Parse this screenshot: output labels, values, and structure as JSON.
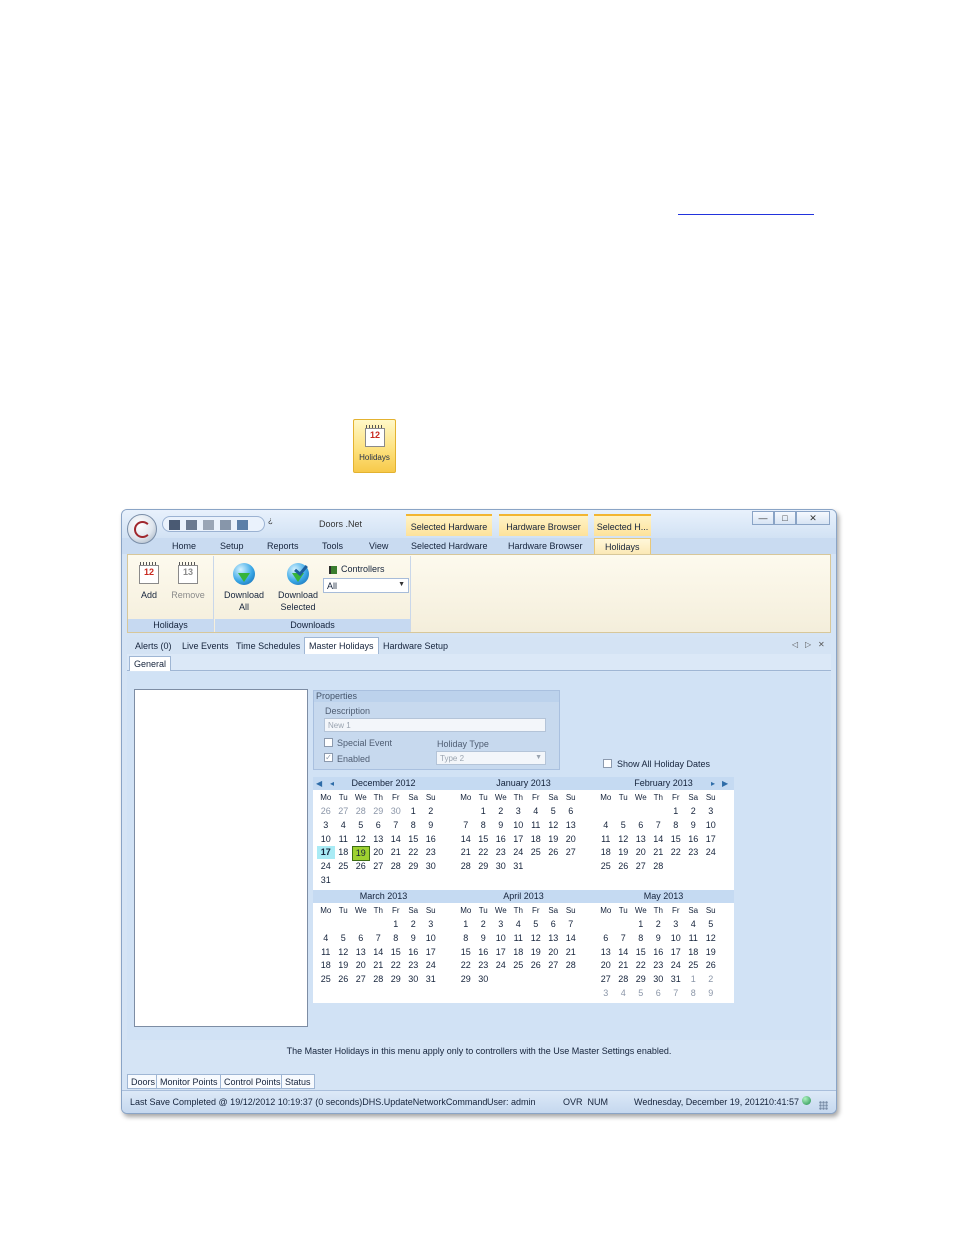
{
  "document": {
    "icon_button_label": "Holidays"
  },
  "window": {
    "quick_access_dropdown": "¿",
    "title": "Doors .Net",
    "context_tabs": [
      "Selected Hardware",
      "Hardware Browser",
      "Selected H..."
    ],
    "controls": {
      "minimize": "—",
      "maximize": "□",
      "close": "✕"
    }
  },
  "menu": {
    "tabs": [
      "Home",
      "Setup",
      "Reports",
      "Tools",
      "View",
      "Selected Hardware",
      "Hardware Browser",
      "Holidays"
    ],
    "active": "Holidays"
  },
  "ribbon": {
    "holidays_group": {
      "caption": "Holidays",
      "add": "Add",
      "remove": "Remove"
    },
    "downloads_group": {
      "caption": "Downloads",
      "download_all": [
        "Download",
        "All"
      ],
      "download_selected": [
        "Download",
        "Selected"
      ],
      "controllers_label": "Controllers",
      "controllers_value": "All"
    }
  },
  "doc_tabs": {
    "items": [
      "Alerts (0)",
      "Live Events",
      "Time Schedules",
      "Master Holidays",
      "Hardware Setup"
    ],
    "active": "Master Holidays",
    "nav": [
      "◁",
      "▷",
      "✕"
    ]
  },
  "sub_tabs": {
    "items": [
      "General"
    ]
  },
  "properties": {
    "caption": "Properties",
    "description_label": "Description",
    "description_value": "New 1",
    "special_event_label": "Special Event",
    "special_event_checked": false,
    "enabled_label": "Enabled",
    "enabled_checked": true,
    "holiday_type_label": "Holiday Type",
    "holiday_type_value": "Type 2"
  },
  "show_all_holiday_dates": {
    "label": "Show All Holiday Dates",
    "checked": false
  },
  "calendar": {
    "weekdays": [
      "Mo",
      "Tu",
      "We",
      "Th",
      "Fr",
      "Sa",
      "Su"
    ],
    "today": "17",
    "selected": "19",
    "months": [
      {
        "title": "December 2012",
        "days": [
          "26",
          "27",
          "28",
          "29",
          "30",
          "1",
          "2",
          "3",
          "4",
          "5",
          "6",
          "7",
          "8",
          "9",
          "10",
          "11",
          "12",
          "13",
          "14",
          "15",
          "16",
          "17",
          "18",
          "19",
          "20",
          "21",
          "22",
          "23",
          "24",
          "25",
          "26",
          "27",
          "28",
          "29",
          "30",
          "31"
        ],
        "lead": 5,
        "trail": 0
      },
      {
        "title": "January 2013",
        "days": [
          "1",
          "2",
          "3",
          "4",
          "5",
          "6",
          "7",
          "8",
          "9",
          "10",
          "11",
          "12",
          "13",
          "14",
          "15",
          "16",
          "17",
          "18",
          "19",
          "20",
          "21",
          "22",
          "23",
          "24",
          "25",
          "26",
          "27",
          "28",
          "29",
          "30",
          "31"
        ],
        "offset": 1
      },
      {
        "title": "February 2013",
        "days": [
          "1",
          "2",
          "3",
          "4",
          "5",
          "6",
          "7",
          "8",
          "9",
          "10",
          "11",
          "12",
          "13",
          "14",
          "15",
          "16",
          "17",
          "18",
          "19",
          "20",
          "21",
          "22",
          "23",
          "24",
          "25",
          "26",
          "27",
          "28"
        ],
        "offset": 4
      },
      {
        "title": "March 2013",
        "days": [
          "1",
          "2",
          "3",
          "4",
          "5",
          "6",
          "7",
          "8",
          "9",
          "10",
          "11",
          "12",
          "13",
          "14",
          "15",
          "16",
          "17",
          "18",
          "19",
          "20",
          "21",
          "22",
          "23",
          "24",
          "25",
          "26",
          "27",
          "28",
          "29",
          "30",
          "31"
        ],
        "offset": 4
      },
      {
        "title": "April 2013",
        "days": [
          "1",
          "2",
          "3",
          "4",
          "5",
          "6",
          "7",
          "8",
          "9",
          "10",
          "11",
          "12",
          "13",
          "14",
          "15",
          "16",
          "17",
          "18",
          "19",
          "20",
          "21",
          "22",
          "23",
          "24",
          "25",
          "26",
          "27",
          "28",
          "29",
          "30"
        ],
        "offset": 0
      },
      {
        "title": "May 2013",
        "days": [
          "1",
          "2",
          "3",
          "4",
          "5",
          "6",
          "7",
          "8",
          "9",
          "10",
          "11",
          "12",
          "13",
          "14",
          "15",
          "16",
          "17",
          "18",
          "19",
          "20",
          "21",
          "22",
          "23",
          "24",
          "25",
          "26",
          "27",
          "28",
          "29",
          "30",
          "31",
          "1",
          "2",
          "3",
          "4",
          "5",
          "6",
          "7",
          "8",
          "9"
        ],
        "offset": 2,
        "trail": 9
      }
    ]
  },
  "footnote": "The Master Holidays in this menu apply only to controllers with the Use Master Settings enabled.",
  "bottom_tabs": [
    "Doors",
    "Monitor Points",
    "Control Points",
    "Status"
  ],
  "status": {
    "last_save": "Last Save Completed @ 19/12/2012 10:19:37 (0 seconds)DHS.UpdateNetworkCommand",
    "user": "User: admin",
    "keys": "OVR  NUM",
    "date": "Wednesday, December 19, 2012",
    "time": "10:41:57"
  },
  "colors": {
    "accent": "#f2b531",
    "ribbon_blue": "#c6d9f1",
    "today": "#a9ebf5",
    "selected": "#9ed130"
  }
}
